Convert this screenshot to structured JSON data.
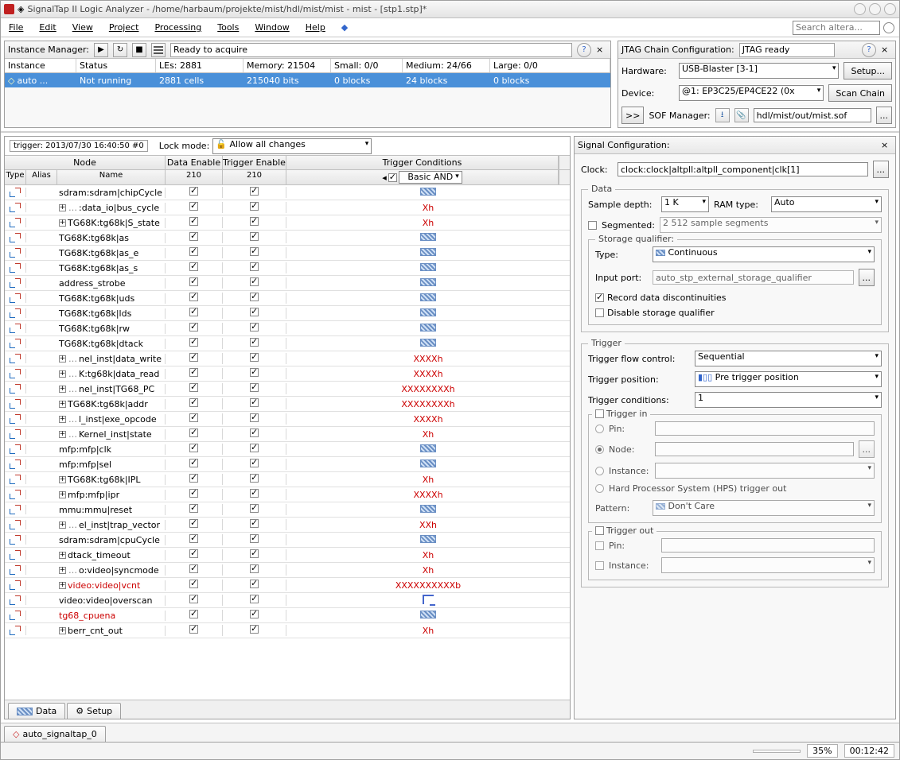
{
  "window": {
    "title": "SignalTap II Logic Analyzer - /home/harbaum/projekte/mist/hdl/mist/mist - mist - [stp1.stp]*"
  },
  "menu": [
    "File",
    "Edit",
    "View",
    "Project",
    "Processing",
    "Tools",
    "Window",
    "Help"
  ],
  "search_placeholder": "Search altera...",
  "instance_manager": {
    "title": "Instance Manager:",
    "status": "Ready to acquire",
    "headers": {
      "instance": "Instance",
      "status": "Status",
      "les": "LEs: 2881",
      "memory": "Memory: 21504",
      "small": "Small: 0/0",
      "medium": "Medium: 24/66",
      "large": "Large: 0/0"
    },
    "row": {
      "instance": "auto ...",
      "status": "Not running",
      "les": "2881 cells",
      "memory": "215040 bits",
      "small": "0 blocks",
      "medium": "24 blocks",
      "large": "0 blocks"
    }
  },
  "jtag": {
    "title": "JTAG Chain Configuration:",
    "status": "JTAG ready",
    "hardware_label": "Hardware:",
    "hardware_value": "USB-Blaster [3-1]",
    "setup_btn": "Setup...",
    "device_label": "Device:",
    "device_value": "@1: EP3C25/EP4CE22 (0x",
    "scan_btn": "Scan Chain",
    "sof_label": "SOF Manager:",
    "sof_path": "hdl/mist/out/mist.sof",
    "more": ">>",
    "ellipsis": "..."
  },
  "trigger_info": "trigger: 2013/07/30 16:40:50  #0",
  "lock_label": "Lock mode:",
  "lock_value": "Allow all changes",
  "sig_headers": {
    "node": "Node",
    "de": "Data Enable",
    "te": "Trigger Enable",
    "tc": "Trigger Conditions",
    "type": "Type",
    "alias": "Alias",
    "name": "Name",
    "de_count": "210",
    "te_count": "210",
    "tc_mode": "Basic AND"
  },
  "signals": [
    {
      "name": "sdram:sdram|chipCycle",
      "exp": false,
      "tc": "wave"
    },
    {
      "name": ":data_io|bus_cycle",
      "exp": true,
      "dots": true,
      "tc": "Xh",
      "red": true
    },
    {
      "name": "TG68K:tg68k|S_state",
      "exp": true,
      "tc": "Xh",
      "red": true
    },
    {
      "name": "TG68K:tg68k|as",
      "exp": false,
      "tc": "wave"
    },
    {
      "name": "TG68K:tg68k|as_e",
      "exp": false,
      "tc": "wave"
    },
    {
      "name": "TG68K:tg68k|as_s",
      "exp": false,
      "tc": "wave"
    },
    {
      "name": "address_strobe",
      "exp": false,
      "tc": "wave"
    },
    {
      "name": "TG68K:tg68k|uds",
      "exp": false,
      "tc": "wave"
    },
    {
      "name": "TG68K:tg68k|lds",
      "exp": false,
      "tc": "wave"
    },
    {
      "name": "TG68K:tg68k|rw",
      "exp": false,
      "tc": "wave"
    },
    {
      "name": "TG68K:tg68k|dtack",
      "exp": false,
      "tc": "wave"
    },
    {
      "name": "nel_inst|data_write",
      "exp": true,
      "dots": true,
      "tc": "XXXXh",
      "red": true
    },
    {
      "name": "K:tg68k|data_read",
      "exp": true,
      "dots": true,
      "tc": "XXXXh",
      "red": true
    },
    {
      "name": "nel_inst|TG68_PC",
      "exp": true,
      "dots": true,
      "tc": "XXXXXXXXh",
      "red": true
    },
    {
      "name": "TG68K:tg68k|addr",
      "exp": true,
      "tc": "XXXXXXXXh",
      "red": true
    },
    {
      "name": "l_inst|exe_opcode",
      "exp": true,
      "dots": true,
      "tc": "XXXXh",
      "red": true
    },
    {
      "name": "Kernel_inst|state",
      "exp": true,
      "dots": true,
      "tc": "Xh",
      "red": true
    },
    {
      "name": "mfp:mfp|clk",
      "exp": false,
      "tc": "wave"
    },
    {
      "name": "mfp:mfp|sel",
      "exp": false,
      "tc": "wave"
    },
    {
      "name": "TG68K:tg68k|IPL",
      "exp": true,
      "tc": "Xh",
      "red": true
    },
    {
      "name": "mfp:mfp|ipr",
      "exp": true,
      "tc": "XXXXh",
      "red": true
    },
    {
      "name": "mmu:mmu|reset",
      "exp": false,
      "tc": "wave"
    },
    {
      "name": "el_inst|trap_vector",
      "exp": true,
      "dots": true,
      "tc": "XXh",
      "red": true
    },
    {
      "name": "sdram:sdram|cpuCycle",
      "exp": false,
      "tc": "wave"
    },
    {
      "name": "dtack_timeout",
      "exp": true,
      "tc": "Xh",
      "red": true
    },
    {
      "name": "o:video|syncmode",
      "exp": true,
      "dots": true,
      "tc": "Xh",
      "red": true
    },
    {
      "name": "video:video|vcnt",
      "exp": true,
      "tc": "XXXXXXXXXXb",
      "red": true,
      "namecolor": "red"
    },
    {
      "name": "video:video|overscan",
      "exp": false,
      "tc": "rise"
    },
    {
      "name": "tg68_cpuena",
      "exp": false,
      "tc": "wave",
      "namecolor": "red"
    },
    {
      "name": "berr_cnt_out",
      "exp": true,
      "tc": "Xh",
      "red": true
    }
  ],
  "tabs": {
    "data": "Data",
    "setup": "Setup",
    "bottom": "auto_signaltap_0"
  },
  "sigcfg": {
    "title": "Signal Configuration:",
    "clock_label": "Clock:",
    "clock_value": "clock:clock|altpll:altpll_component|clk[1]",
    "data_legend": "Data",
    "sample_depth_label": "Sample depth:",
    "sample_depth_value": "1 K",
    "ram_type_label": "RAM type:",
    "ram_type_value": "Auto",
    "segmented_label": "Segmented:",
    "segmented_value": "2  512 sample segments",
    "storage_legend": "Storage qualifier:",
    "type_label": "Type:",
    "type_value": "Continuous",
    "input_port_label": "Input port:",
    "input_port_value": "auto_stp_external_storage_qualifier",
    "record_disc": "Record data discontinuities",
    "disable_sq": "Disable storage qualifier",
    "trigger_legend": "Trigger",
    "flow_label": "Trigger flow control:",
    "flow_value": "Sequential",
    "pos_label": "Trigger position:",
    "pos_value": "Pre trigger position",
    "cond_label": "Trigger conditions:",
    "cond_value": "1",
    "trigger_in_legend": "Trigger in",
    "pin_label": "Pin:",
    "node_label": "Node:",
    "instance_label": "Instance:",
    "hps_label": "Hard Processor System (HPS) trigger out",
    "pattern_label": "Pattern:",
    "pattern_value": "Don't Care",
    "trigger_out_legend": "Trigger out",
    "ellipsis": "..."
  },
  "statusbar": {
    "pct": "35%",
    "time": "00:12:42"
  }
}
